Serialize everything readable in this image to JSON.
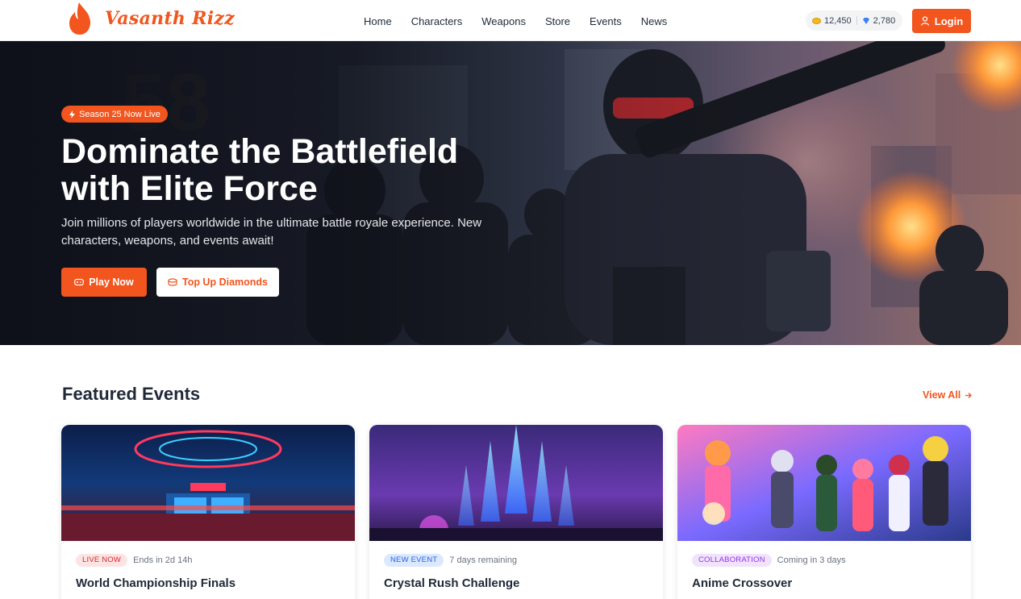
{
  "brand": {
    "name": "Vasanth Rizz",
    "accent": "#f2551d"
  },
  "nav": {
    "items": [
      "Home",
      "Characters",
      "Weapons",
      "Store",
      "Events",
      "News"
    ]
  },
  "currency": {
    "coins": "12,450",
    "diamonds": "2,780"
  },
  "login_label": "Login",
  "hero": {
    "badge": "Season 25 Now Live",
    "title_line1": "Dominate the Battlefield",
    "title_line2": "with Elite Force",
    "description": "Join millions of players worldwide in the ultimate battle royale experience. New characters, weapons, and events await!",
    "primary_cta": "Play Now",
    "secondary_cta": "Top Up Diamonds"
  },
  "featured": {
    "title": "Featured Events",
    "view_all": "View All",
    "events": [
      {
        "tag": "LIVE NOW",
        "tag_color": "#fde4e4",
        "tag_text_color": "#dc2626",
        "meta": "Ends in 2d 14h",
        "title": "World Championship Finals"
      },
      {
        "tag": "NEW EVENT",
        "tag_color": "#dbe8fe",
        "tag_text_color": "#2563eb",
        "meta": "7 days remaining",
        "title": "Crystal Rush Challenge"
      },
      {
        "tag": "COLLABORATION",
        "tag_color": "#f1e3fd",
        "tag_text_color": "#9333ea",
        "meta": "Coming in 3 days",
        "title": "Anime Crossover"
      }
    ]
  }
}
